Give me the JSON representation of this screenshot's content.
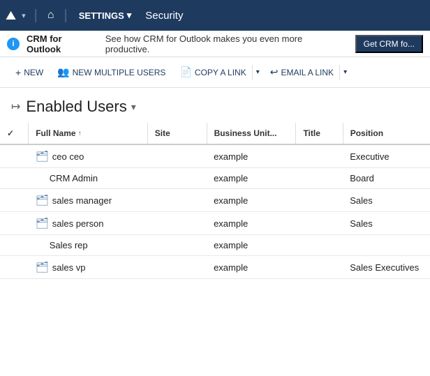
{
  "nav": {
    "logo_icon": "▲▲",
    "dropdown_arrow": "▾",
    "home_icon": "⌂",
    "settings_label": "SETTINGS",
    "settings_arrow": "▾",
    "separator": "|",
    "security_label": "Security"
  },
  "banner": {
    "info_icon": "i",
    "title": "CRM for Outlook",
    "text": "See how CRM for Outlook makes you even more productive.",
    "cta_label": "Get CRM fo..."
  },
  "toolbar": {
    "new_label": "NEW",
    "new_icon": "+",
    "new_multiple_label": "NEW MULTIPLE USERS",
    "new_multiple_icon": "👥",
    "copy_label": "COPY A LINK",
    "copy_icon": "📄",
    "copy_arrow": "▾",
    "email_label": "EMAIL A LINK",
    "email_icon": "↩",
    "email_arrow": "▾"
  },
  "page": {
    "pin_icon": "↦",
    "title": "Enabled Users",
    "title_arrow": "▾"
  },
  "table": {
    "columns": [
      {
        "key": "check",
        "label": "✓",
        "sortable": false
      },
      {
        "key": "full_name",
        "label": "Full Name",
        "sortable": true
      },
      {
        "key": "site",
        "label": "Site",
        "sortable": false
      },
      {
        "key": "business_unit",
        "label": "Business Unit...",
        "sortable": false
      },
      {
        "key": "title",
        "label": "Title",
        "sortable": false
      },
      {
        "key": "position",
        "label": "Position",
        "sortable": false
      }
    ],
    "rows": [
      {
        "has_icon": true,
        "full_name": "ceo ceo",
        "site": "",
        "business_unit": "example",
        "title": "",
        "position": "Executive"
      },
      {
        "has_icon": false,
        "full_name": "CRM Admin",
        "site": "",
        "business_unit": "example",
        "title": "",
        "position": "Board"
      },
      {
        "has_icon": true,
        "full_name": "sales manager",
        "site": "",
        "business_unit": "example",
        "title": "",
        "position": "Sales"
      },
      {
        "has_icon": true,
        "full_name": "sales person",
        "site": "",
        "business_unit": "example",
        "title": "",
        "position": "Sales"
      },
      {
        "has_icon": false,
        "full_name": "Sales rep",
        "site": "",
        "business_unit": "example",
        "title": "",
        "position": ""
      },
      {
        "has_icon": true,
        "full_name": "sales vp",
        "site": "",
        "business_unit": "example",
        "title": "",
        "position": "Sales Executives"
      }
    ]
  }
}
